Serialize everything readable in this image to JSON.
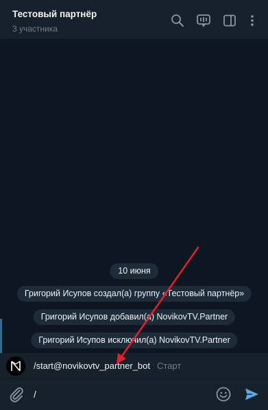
{
  "header": {
    "title": "Тестовый партнёр",
    "subtitle": "3 участника",
    "icons": [
      "search-icon",
      "voice-chat-icon",
      "sidebar-toggle-icon",
      "more-icon"
    ]
  },
  "chat": {
    "date": "10 июня",
    "service_messages": [
      "Григорий Исупов создал(а) группу «Тестовый партнёр»",
      "Григорий Исупов добавил(а) NovikovTV.Partner",
      "Григорий Исупов исключил(а) NovikovTV.Partner"
    ]
  },
  "command_suggestion": {
    "command": "/start@novikovtv_partner_bot",
    "description": "Старт"
  },
  "composer": {
    "value": "/",
    "icons": [
      "attach-icon",
      "emoji-icon",
      "send-icon"
    ]
  },
  "colors": {
    "background": "#0e1621",
    "panel": "#17212b",
    "pill": "#1e2c3a",
    "accent": "#5fa8e5",
    "annotation_arrow": "#e5202a"
  }
}
